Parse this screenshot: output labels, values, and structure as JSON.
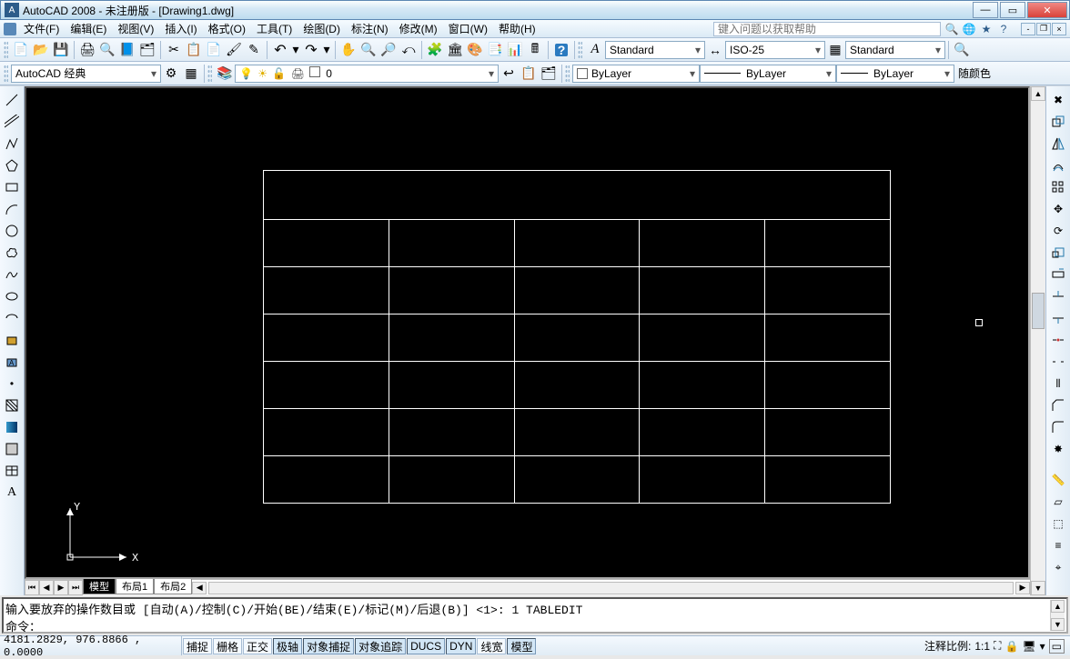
{
  "title": "AutoCAD 2008 - 未注册版 - [Drawing1.dwg]",
  "menus": {
    "file": "文件(F)",
    "edit": "编辑(E)",
    "view": "视图(V)",
    "insert": "插入(I)",
    "format": "格式(O)",
    "tools": "工具(T)",
    "draw": "绘图(D)",
    "dimension": "标注(N)",
    "modify": "修改(M)",
    "window": "窗口(W)",
    "help": "帮助(H)"
  },
  "help_search_placeholder": "键入问题以获取帮助",
  "workspace_combo": "AutoCAD 经典",
  "layer_combo": "0",
  "row1_styles": {
    "text_style": "Standard",
    "dim_style": "ISO-25",
    "table_style": "Standard"
  },
  "bylayer": {
    "color": "ByLayer",
    "linetype": "ByLayer",
    "lineweight": "ByLayer",
    "plot": "随颜色"
  },
  "view_tabs": {
    "model": "模型",
    "layout1": "布局1",
    "layout2": "布局2"
  },
  "cmd": {
    "line1": "输入要放弃的操作数目或 [自动(A)/控制(C)/开始(BE)/结束(E)/标记(M)/后退(B)] <1>: 1 TABLEDIT",
    "line2": "命令："
  },
  "status": {
    "coords": "4181.2829, 976.8866 , 0.0000",
    "snap": "捕捉",
    "grid": "栅格",
    "ortho": "正交",
    "polar": "极轴",
    "osnap": "对象捕捉",
    "otrack": "对象追踪",
    "ducs": "DUCS",
    "dyn": "DYN",
    "lwt": "线宽",
    "model": "模型",
    "anno_label": "注释比例:",
    "anno_scale": "1:1"
  },
  "ucs": {
    "x": "X",
    "y": "Y"
  },
  "table": {
    "rows": 7,
    "cols": 5
  }
}
